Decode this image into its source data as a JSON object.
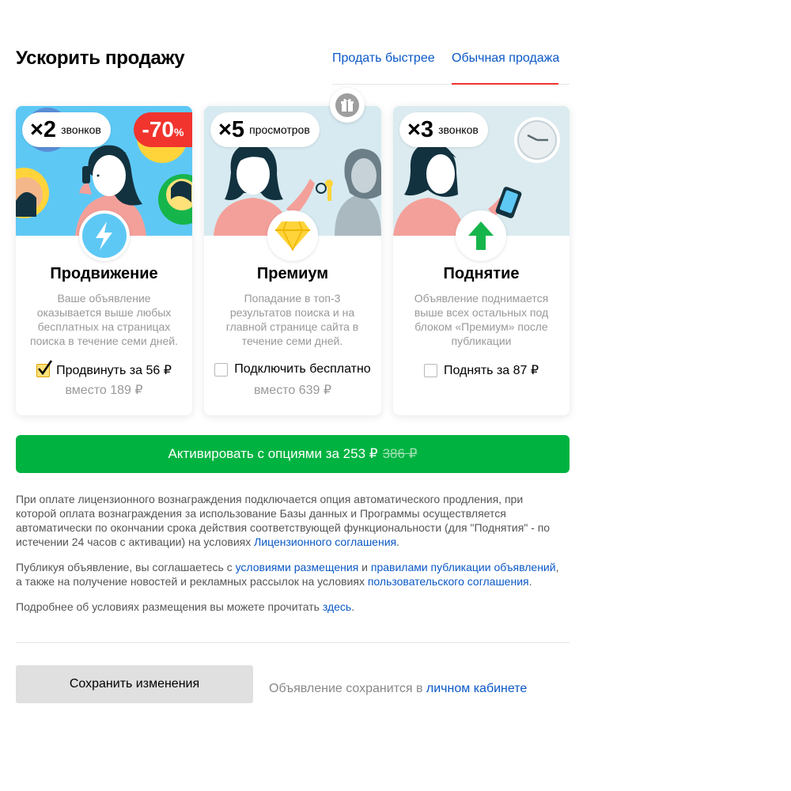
{
  "header": {
    "title": "Ускорить продажу",
    "tabs": [
      {
        "label": "Продать быстрее",
        "active": false
      },
      {
        "label": "Обычная продажа",
        "active": true
      }
    ]
  },
  "cards": [
    {
      "badge_multiplier": "×2",
      "badge_unit": "звонков",
      "discount_value": "-70",
      "discount_percent": "%",
      "icon": "lightning-icon",
      "title": "Продвижение",
      "description": "Ваше объявление оказывается выше любых бесплатных на страницах поиска в течение семи дней.",
      "option_label": "Продвинуть за 56 ₽",
      "option_checked": true,
      "old_price": "вместо 189 ₽",
      "bg_color": "#5ec8f5"
    },
    {
      "badge_multiplier": "×5",
      "badge_unit": "просмотров",
      "icon": "diamond-icon",
      "title": "Премиум",
      "description": "Попадание в топ-3 результатов поиска и на главной странице сайта в течение семи дней.",
      "option_label": "Подключить бесплатно",
      "option_checked": false,
      "old_price": "вместо 639 ₽",
      "bg_color": "#d7eaf1"
    },
    {
      "badge_multiplier": "×3",
      "badge_unit": "звонков",
      "icon": "arrow-up-icon",
      "title": "Поднятие",
      "description": "Объявление поднимается выше всех остальных под блоком «Премиум» после публикации",
      "option_label": "Поднять за 87 ₽",
      "option_checked": false,
      "bg_color": "#dbebf0"
    }
  ],
  "activate": {
    "label": "Активировать с опциями за 253 ₽",
    "old_price": "386 ₽",
    "color": "#00b341"
  },
  "legal": {
    "p1_text": "При оплате лицензионного вознаграждения подключается опция автоматического продления, при которой оплата вознаграждения за использование Базы данных и Программы осуществляется автоматически по окончании срока действия соответствующей функциональности (для \"Поднятия\" - по истечении 24 часов с активации) на условиях ",
    "p1_link": "Лицензионного соглашения",
    "p1_end": ".",
    "p2_text": "Публикуя объявление, вы соглашаетесь с ",
    "p2_link1": "условиями размещения",
    "p2_and": " и ",
    "p2_link2": "правилами публикации объявлений",
    "p2_mid": ", а также на получение новостей и рекламных рассылок на условиях ",
    "p2_link3": "пользовательского соглашения",
    "p2_end": ".",
    "p3_text": "Подробнее об условиях размещения вы можете прочитать ",
    "p3_link": "здесь",
    "p3_end": "."
  },
  "footer": {
    "save_label": "Сохранить изменения",
    "note_text": "Объявление сохранится в ",
    "note_link": "личном кабинете"
  },
  "colors": {
    "accent_red": "#f1342e",
    "link": "#0a58c6",
    "green": "#00b341"
  }
}
